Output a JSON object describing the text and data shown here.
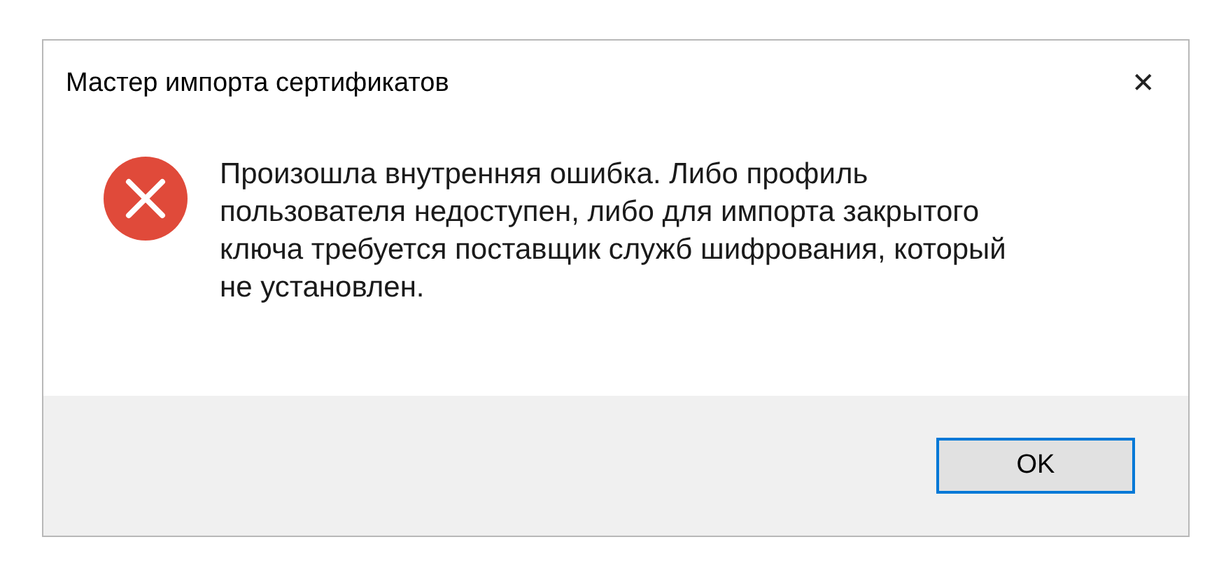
{
  "window": {
    "title": "Мастер импорта сертификатов",
    "close": "✕"
  },
  "message": {
    "text": "Произошла внутренняя ошибка. Либо профиль пользователя недоступен, либо для импорта закрытого ключа требуется поставщик служб шифрования, который не установлен."
  },
  "buttons": [
    {
      "label": "OK",
      "default": true
    }
  ]
}
